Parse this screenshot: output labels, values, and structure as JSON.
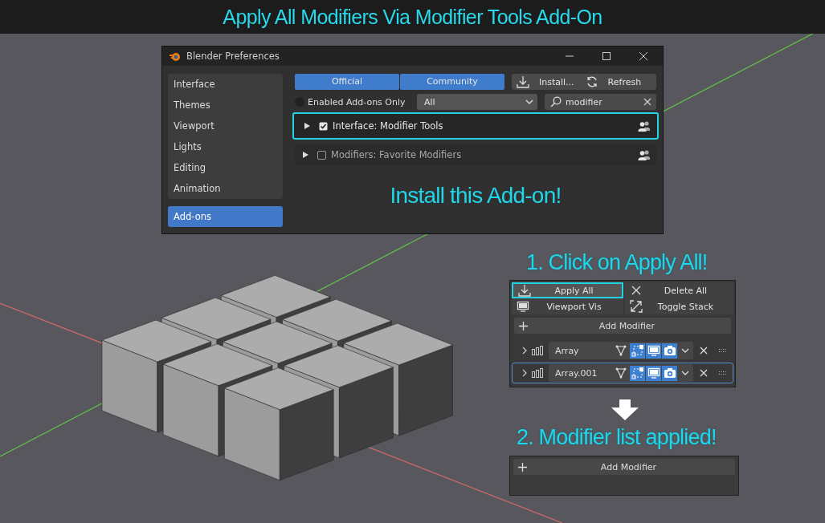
{
  "banner": {
    "title": "Apply All Modifiers Via Modifier Tools Add-On"
  },
  "preferences_window": {
    "title": "Blender Preferences",
    "sidebar": {
      "items": [
        {
          "label": "Interface",
          "selected": false
        },
        {
          "label": "Themes",
          "selected": false
        },
        {
          "label": "Viewport",
          "selected": false
        },
        {
          "label": "Lights",
          "selected": false
        },
        {
          "label": "Editing",
          "selected": false
        },
        {
          "label": "Animation",
          "selected": false
        },
        {
          "label": "Add-ons",
          "selected": true
        }
      ]
    },
    "source_tabs": [
      {
        "label": "Official",
        "selected": true
      },
      {
        "label": "Community",
        "selected": true
      }
    ],
    "install_button": "Install...",
    "refresh_button": "Refresh",
    "enabled_only": {
      "label": "Enabled Add-ons Only",
      "checked": false
    },
    "category": "All",
    "search": {
      "value": "modifier"
    },
    "addons": [
      {
        "label": "Interface: Modifier Tools",
        "enabled": true,
        "highlighted": true
      },
      {
        "label": "Modifiers: Favorite Modifiers",
        "enabled": false,
        "highlighted": false
      }
    ],
    "callout": "Install this Add-on!"
  },
  "step_1": {
    "caption": "1. Click on Apply All!",
    "buttons": [
      {
        "label": "Apply All",
        "kind": "apply",
        "highlighted": true
      },
      {
        "label": "Delete All",
        "kind": "delete",
        "highlighted": false
      },
      {
        "label": "Viewport Vis",
        "kind": "visibility",
        "highlighted": false
      },
      {
        "label": "Toggle Stack",
        "kind": "toggle",
        "highlighted": false
      }
    ],
    "add_modifier": "Add Modifier",
    "modifiers": [
      {
        "name": "Array",
        "selected": false,
        "edit_mode": true,
        "viewport": true,
        "render": true
      },
      {
        "name": "Array.001",
        "selected": true,
        "edit_mode": true,
        "viewport": true,
        "render": true
      }
    ]
  },
  "step_2": {
    "caption": "2. Modifier list applied!",
    "add_modifier": "Add Modifier"
  }
}
